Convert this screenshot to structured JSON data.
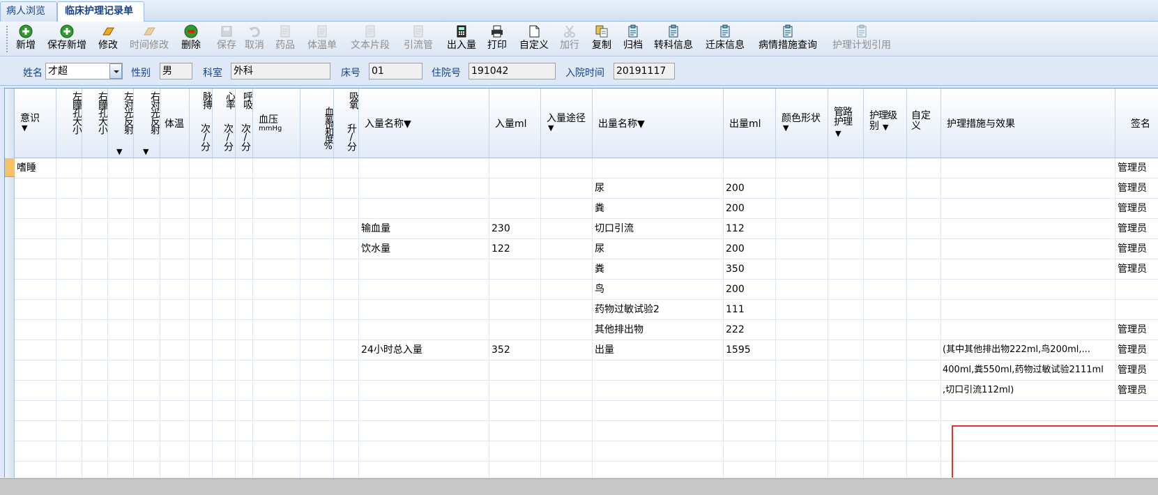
{
  "tabs": [
    {
      "label": "病人浏览",
      "active": false
    },
    {
      "label": "临床护理记录单",
      "active": true
    }
  ],
  "toolbar": [
    {
      "label": "新增",
      "icon": "add-circle-icon",
      "enabled": true
    },
    {
      "label": "保存新增",
      "icon": "add-circle-icon",
      "enabled": true
    },
    {
      "label": "修改",
      "icon": "eraser-edit-icon",
      "enabled": true
    },
    {
      "label": "时间修改",
      "icon": "eraser-edit-icon",
      "enabled": false
    },
    {
      "label": "删除",
      "icon": "remove-circle-icon",
      "enabled": true
    },
    {
      "label": "保存",
      "icon": "floppy-disk-icon",
      "enabled": false
    },
    {
      "label": "取消",
      "icon": "undo-icon",
      "enabled": false
    },
    {
      "label": "药品",
      "icon": "document-icon",
      "enabled": false
    },
    {
      "label": "体温单",
      "icon": "document-icon",
      "enabled": false
    },
    {
      "label": "文本片段",
      "icon": "document-icon",
      "enabled": false
    },
    {
      "label": "引流管",
      "icon": "document-icon",
      "enabled": false
    },
    {
      "label": "出入量",
      "icon": "calculator-icon",
      "enabled": true
    },
    {
      "label": "打印",
      "icon": "printer-icon",
      "enabled": true
    },
    {
      "label": "自定义",
      "icon": "blank-page-icon",
      "enabled": true
    },
    {
      "label": "加行",
      "icon": "scissors-icon",
      "enabled": false
    },
    {
      "label": "复制",
      "icon": "copy-icon",
      "enabled": true
    },
    {
      "label": "归档",
      "icon": "clipboard-icon",
      "enabled": true
    },
    {
      "label": "转科信息",
      "icon": "clipboard-icon",
      "enabled": true
    },
    {
      "label": "迁床信息",
      "icon": "clipboard-icon",
      "enabled": true
    },
    {
      "label": "病情措施查询",
      "icon": "clipboard-icon",
      "enabled": true
    },
    {
      "label": "护理计划引用",
      "icon": "clipboard-icon",
      "enabled": false
    }
  ],
  "form": {
    "name_label": "姓名",
    "name_value": "才超",
    "sex_label": "性别",
    "sex_value": "男",
    "dept_label": "科室",
    "dept_value": "外科",
    "bed_label": "床号",
    "bed_value": "01",
    "admission_no_label": "住院号",
    "admission_no_value": "191042",
    "admission_time_label": "入院时间",
    "admission_time_value": "20191117"
  },
  "columns": {
    "yishi": "意识",
    "tongkong_left": "左瞳孔大小",
    "tongkong_right": "右瞳孔大小",
    "fanshe_left": "左对光反射",
    "fanshe_right": "右对光反射",
    "tiwen": "体温",
    "maibo": "脉搏",
    "xinlv": "心率",
    "huxi": "呼吸",
    "per_min": "次/分",
    "xueya": "血压",
    "xueya_unit": "mmHg",
    "spo2": "血氧饱和度%",
    "xiyang": "吸氧",
    "xiyang_unit": "升/分",
    "in_name": "入量名称▼",
    "in_ml": "入量ml",
    "in_route": "入量途径",
    "out_name": "出量名称▼",
    "out_ml": "出量ml",
    "color": "颜色形状",
    "tube": "管路护理",
    "level": "护理级别",
    "custom": "自定义",
    "measures": "护理措施与效果",
    "sign": "签名",
    "dropdown_mark": "▼"
  },
  "rows": [
    {
      "yishi": "嗜睡",
      "in_name": "",
      "in_ml": "",
      "out_name": "",
      "out_ml": "",
      "measures": "",
      "sign": "管理员"
    },
    {
      "yishi": "",
      "in_name": "",
      "in_ml": "",
      "out_name": "尿",
      "out_ml": "200",
      "measures": "",
      "sign": "管理员"
    },
    {
      "yishi": "",
      "in_name": "",
      "in_ml": "",
      "out_name": "粪",
      "out_ml": "200",
      "measures": "",
      "sign": "管理员"
    },
    {
      "yishi": "",
      "in_name": "输血量",
      "in_ml": "230",
      "out_name": "切口引流",
      "out_ml": "112",
      "measures": "",
      "sign": "管理员"
    },
    {
      "yishi": "",
      "in_name": "饮水量",
      "in_ml": "122",
      "out_name": "尿",
      "out_ml": "200",
      "measures": "",
      "sign": "管理员"
    },
    {
      "yishi": "",
      "in_name": "",
      "in_ml": "",
      "out_name": "粪",
      "out_ml": "350",
      "measures": "",
      "sign": "管理员"
    },
    {
      "yishi": "",
      "in_name": "",
      "in_ml": "",
      "out_name": "鸟",
      "out_ml": "200",
      "measures": "",
      "sign": ""
    },
    {
      "yishi": "",
      "in_name": "",
      "in_ml": "",
      "out_name": "药物过敏试验2",
      "out_ml": "111",
      "measures": "",
      "sign": ""
    },
    {
      "yishi": "",
      "in_name": "",
      "in_ml": "",
      "out_name": "其他排出物",
      "out_ml": "222",
      "measures": "",
      "sign": "管理员"
    },
    {
      "yishi": "",
      "in_name": "24小时总入量",
      "in_ml": "352",
      "out_name": "出量",
      "out_ml": "1595",
      "measures": "(其中其他排出物222ml,鸟200ml,...",
      "sign": "管理员"
    },
    {
      "yishi": "",
      "in_name": "",
      "in_ml": "",
      "out_name": "",
      "out_ml": "",
      "measures": "400ml,粪550ml,药物过敏试验2111ml",
      "sign": "管理员"
    },
    {
      "yishi": "",
      "in_name": "",
      "in_ml": "",
      "out_name": "",
      "out_ml": "",
      "measures": ",切口引流112ml)",
      "sign": "管理员"
    },
    {
      "yishi": "",
      "in_name": "",
      "in_ml": "",
      "out_name": "",
      "out_ml": "",
      "measures": "",
      "sign": ""
    },
    {
      "yishi": "",
      "in_name": "",
      "in_ml": "",
      "out_name": "",
      "out_ml": "",
      "measures": "",
      "sign": ""
    },
    {
      "yishi": "",
      "in_name": "",
      "in_ml": "",
      "out_name": "",
      "out_ml": "",
      "measures": "",
      "sign": ""
    },
    {
      "yishi": "",
      "in_name": "",
      "in_ml": "",
      "out_name": "",
      "out_ml": "",
      "measures": "",
      "sign": ""
    }
  ]
}
